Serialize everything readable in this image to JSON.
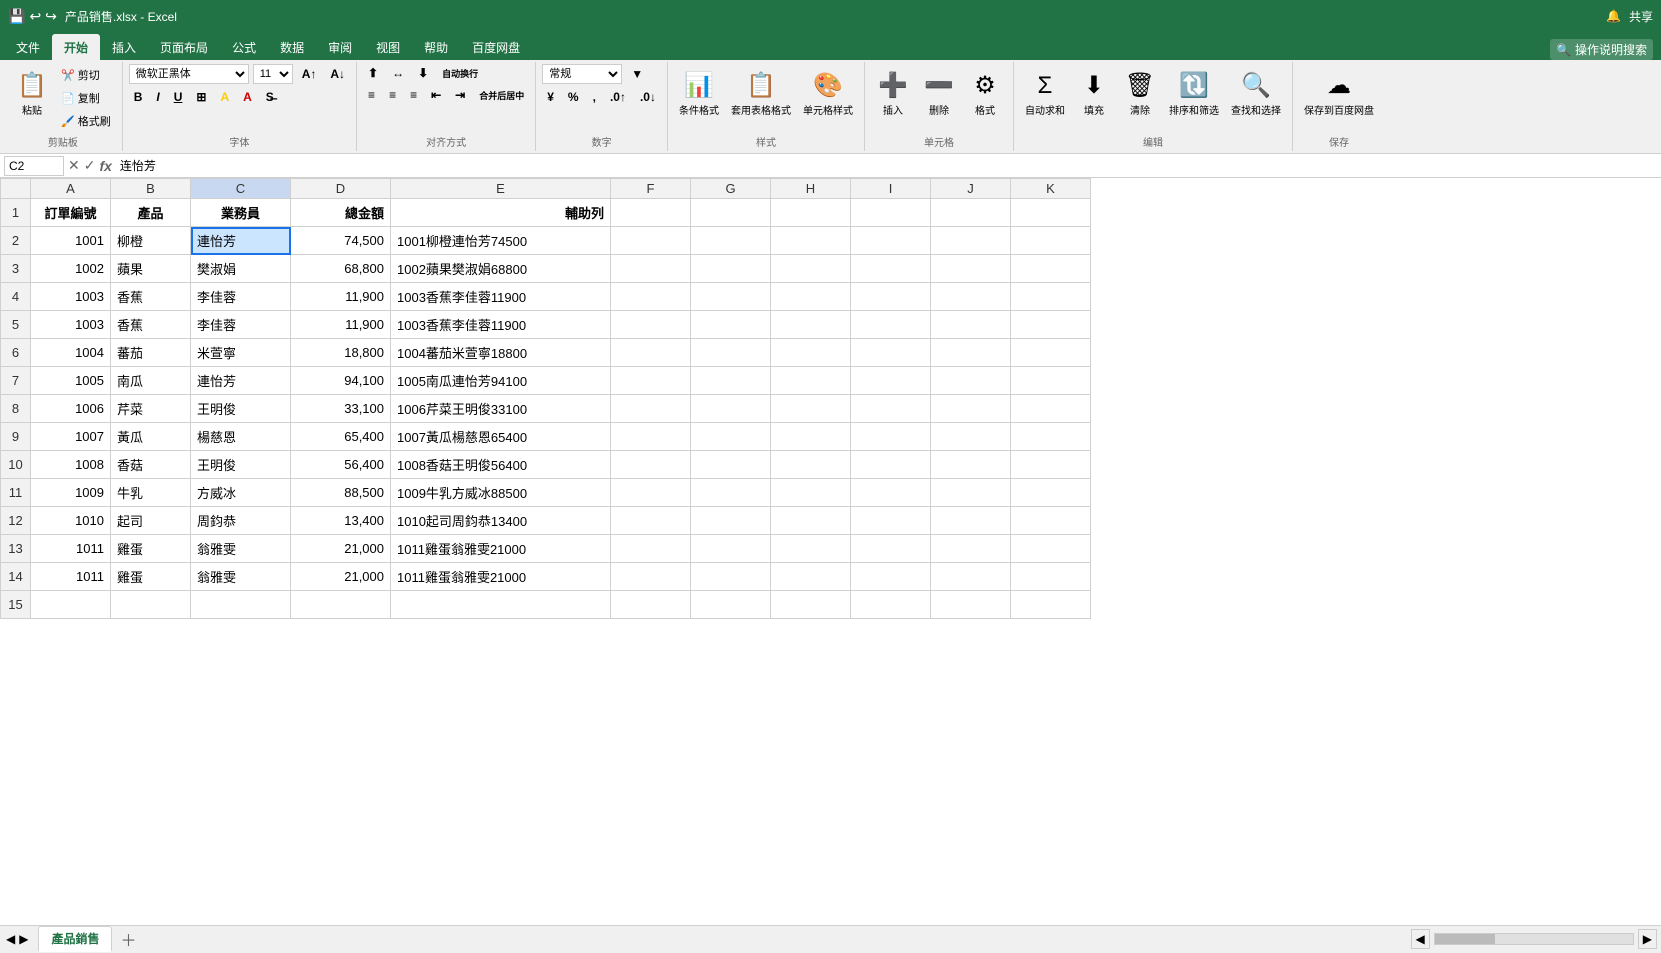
{
  "titlebar": {
    "title": "产品销售.xlsx - Excel",
    "icons": [
      "💾",
      "↩",
      "↪"
    ],
    "right": [
      "🔔",
      "共享"
    ]
  },
  "ribbon": {
    "tabs": [
      "文件",
      "开始",
      "插入",
      "页面布局",
      "公式",
      "数据",
      "审阅",
      "视图",
      "帮助",
      "百度网盘"
    ],
    "active_tab": "开始",
    "search_placeholder": "操作说明搜索",
    "groups": {
      "clipboard": {
        "label": "剪贴板",
        "paste": "粘贴",
        "cut": "剪切",
        "copy": "复制",
        "format_painter": "格式刷"
      },
      "font": {
        "label": "字体",
        "font_name": "微软正黑体",
        "font_size": "11",
        "bold": "B",
        "italic": "I",
        "underline": "U",
        "border": "⊞",
        "fill": "A",
        "font_color": "A"
      },
      "alignment": {
        "label": "对齐方式",
        "wrap": "自动换行",
        "merge": "合并后居中"
      },
      "number": {
        "label": "数字",
        "format": "常规"
      },
      "styles": {
        "label": "样式",
        "conditional": "条件格式",
        "table": "套用表格格式",
        "cell_styles": "单元格样式"
      },
      "cells": {
        "label": "单元格",
        "insert": "插入",
        "delete": "删除",
        "format": "格式"
      },
      "editing": {
        "label": "编辑",
        "autosum": "自动求和",
        "fill": "填充",
        "clear": "清除",
        "sort_filter": "排序和筛选",
        "find": "查找和选择"
      },
      "save": {
        "label": "保存",
        "save_to_baidu": "保存到百度网盘"
      }
    }
  },
  "formula_bar": {
    "cell_ref": "C2",
    "formula": "连怡芳"
  },
  "columns": {
    "headers": [
      "",
      "A",
      "B",
      "C",
      "D",
      "E",
      "F",
      "G",
      "H",
      "I",
      "J",
      "K"
    ],
    "col_labels": {
      "A": "A",
      "B": "B",
      "C": "C",
      "D": "D",
      "E": "E",
      "F": "F",
      "G": "G",
      "H": "H",
      "I": "I",
      "J": "J",
      "K": "K"
    }
  },
  "rows": [
    {
      "row": 1,
      "A": "訂單編號",
      "B": "產品",
      "C": "業務員",
      "D": "總金額",
      "E": "輔助列",
      "F": "",
      "G": "",
      "H": "",
      "I": "",
      "J": "",
      "K": ""
    },
    {
      "row": 2,
      "A": "1001",
      "B": "柳橙",
      "C": "連怡芳",
      "D": "74,500",
      "E": "1001柳橙連怡芳74500",
      "F": "",
      "G": "",
      "H": "",
      "I": "",
      "J": "",
      "K": ""
    },
    {
      "row": 3,
      "A": "1002",
      "B": "蘋果",
      "C": "樊淑娟",
      "D": "68,800",
      "E": "1002蘋果樊淑娟68800",
      "F": "",
      "G": "",
      "H": "",
      "I": "",
      "J": "",
      "K": ""
    },
    {
      "row": 4,
      "A": "1003",
      "B": "香蕉",
      "C": "李佳蓉",
      "D": "11,900",
      "E": "1003香蕉李佳蓉11900",
      "F": "",
      "G": "",
      "H": "",
      "I": "",
      "J": "",
      "K": ""
    },
    {
      "row": 5,
      "A": "1003",
      "B": "香蕉",
      "C": "李佳蓉",
      "D": "11,900",
      "E": "1003香蕉李佳蓉11900",
      "F": "",
      "G": "",
      "H": "",
      "I": "",
      "J": "",
      "K": ""
    },
    {
      "row": 6,
      "A": "1004",
      "B": "蕃茄",
      "C": "米萱寧",
      "D": "18,800",
      "E": "1004蕃茄米萱寧18800",
      "F": "",
      "G": "",
      "H": "",
      "I": "",
      "J": "",
      "K": ""
    },
    {
      "row": 7,
      "A": "1005",
      "B": "南瓜",
      "C": "連怡芳",
      "D": "94,100",
      "E": "1005南瓜連怡芳94100",
      "F": "",
      "G": "",
      "H": "",
      "I": "",
      "J": "",
      "K": ""
    },
    {
      "row": 8,
      "A": "1006",
      "B": "芹菜",
      "C": "王明俊",
      "D": "33,100",
      "E": "1006芹菜王明俊33100",
      "F": "",
      "G": "",
      "H": "",
      "I": "",
      "J": "",
      "K": ""
    },
    {
      "row": 9,
      "A": "1007",
      "B": "黃瓜",
      "C": "楊慈恩",
      "D": "65,400",
      "E": "1007黃瓜楊慈恩65400",
      "F": "",
      "G": "",
      "H": "",
      "I": "",
      "J": "",
      "K": ""
    },
    {
      "row": 10,
      "A": "1008",
      "B": "香菇",
      "C": "王明俊",
      "D": "56,400",
      "E": "1008香菇王明俊56400",
      "F": "",
      "G": "",
      "H": "",
      "I": "",
      "J": "",
      "K": ""
    },
    {
      "row": 11,
      "A": "1009",
      "B": "牛乳",
      "C": "方威冰",
      "D": "88,500",
      "E": "1009牛乳方威冰88500",
      "F": "",
      "G": "",
      "H": "",
      "I": "",
      "J": "",
      "K": ""
    },
    {
      "row": 12,
      "A": "1010",
      "B": "起司",
      "C": "周鈞恭",
      "D": "13,400",
      "E": "1010起司周鈞恭13400",
      "F": "",
      "G": "",
      "H": "",
      "I": "",
      "J": "",
      "K": ""
    },
    {
      "row": 13,
      "A": "1011",
      "B": "雞蛋",
      "C": "翁雅雯",
      "D": "21,000",
      "E": "1011雞蛋翁雅雯21000",
      "F": "",
      "G": "",
      "H": "",
      "I": "",
      "J": "",
      "K": ""
    },
    {
      "row": 14,
      "A": "1011",
      "B": "雞蛋",
      "C": "翁雅雯",
      "D": "21,000",
      "E": "1011雞蛋翁雅雯21000",
      "F": "",
      "G": "",
      "H": "",
      "I": "",
      "J": "",
      "K": ""
    },
    {
      "row": 15,
      "A": "",
      "B": "",
      "C": "",
      "D": "",
      "E": "",
      "F": "",
      "G": "",
      "H": "",
      "I": "",
      "J": "",
      "K": ""
    }
  ],
  "sheet_tabs": [
    "產品銷售"
  ],
  "active_sheet": "產品銷售",
  "selected_cell": "C2",
  "status_bar": {
    "left": "",
    "right": ""
  }
}
